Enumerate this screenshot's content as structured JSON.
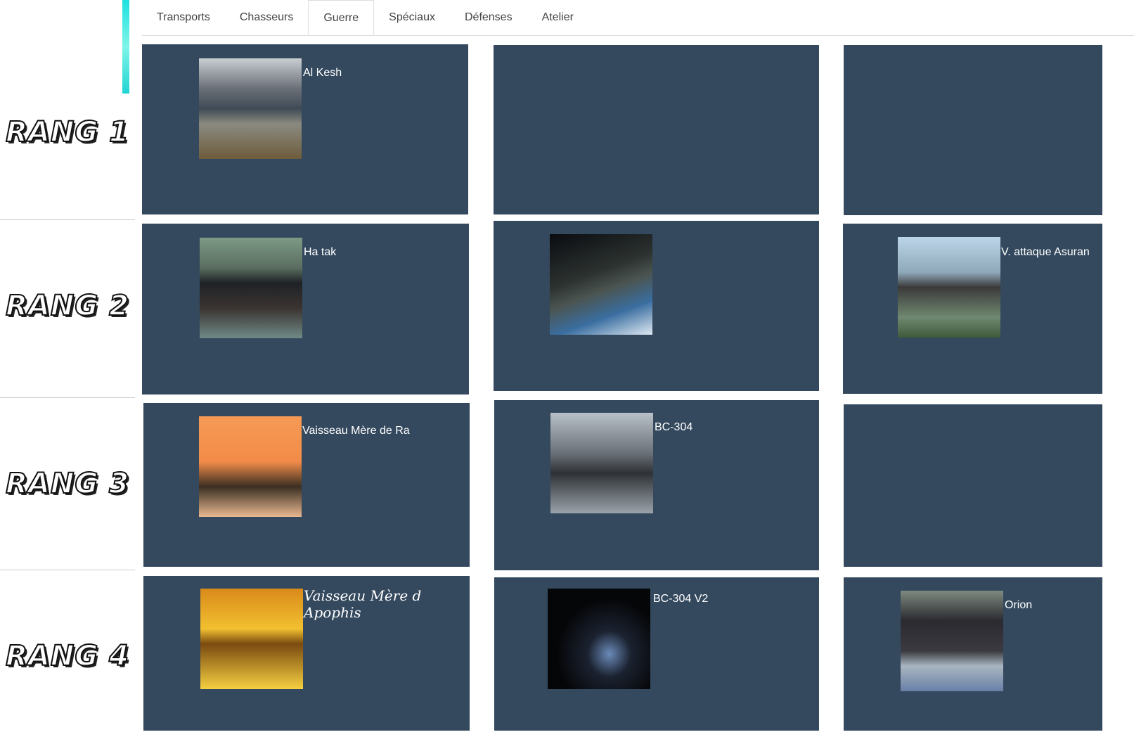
{
  "tabs": [
    {
      "label": "Transports"
    },
    {
      "label": "Chasseurs"
    },
    {
      "label": "Guerre",
      "active": true
    },
    {
      "label": "Spéciaux"
    },
    {
      "label": "Défenses"
    },
    {
      "label": "Atelier"
    }
  ],
  "ranks": [
    {
      "label": "RANG 1"
    },
    {
      "label": "RANG 2"
    },
    {
      "label": "RANG 3"
    },
    {
      "label": "RANG 4"
    }
  ],
  "panel_color": "#34495e",
  "ships": {
    "r1c1": "Al Kesh",
    "r2c1": "Ha tak",
    "r2c3": "V. attaque Asuran",
    "r3c1": "Vaisseau Mère de Ra",
    "r3c2": "BC-304",
    "r4c1": "Vaisseau Mère d Apophis",
    "r4c2": "BC-304 V2",
    "r4c3": "Orion"
  }
}
